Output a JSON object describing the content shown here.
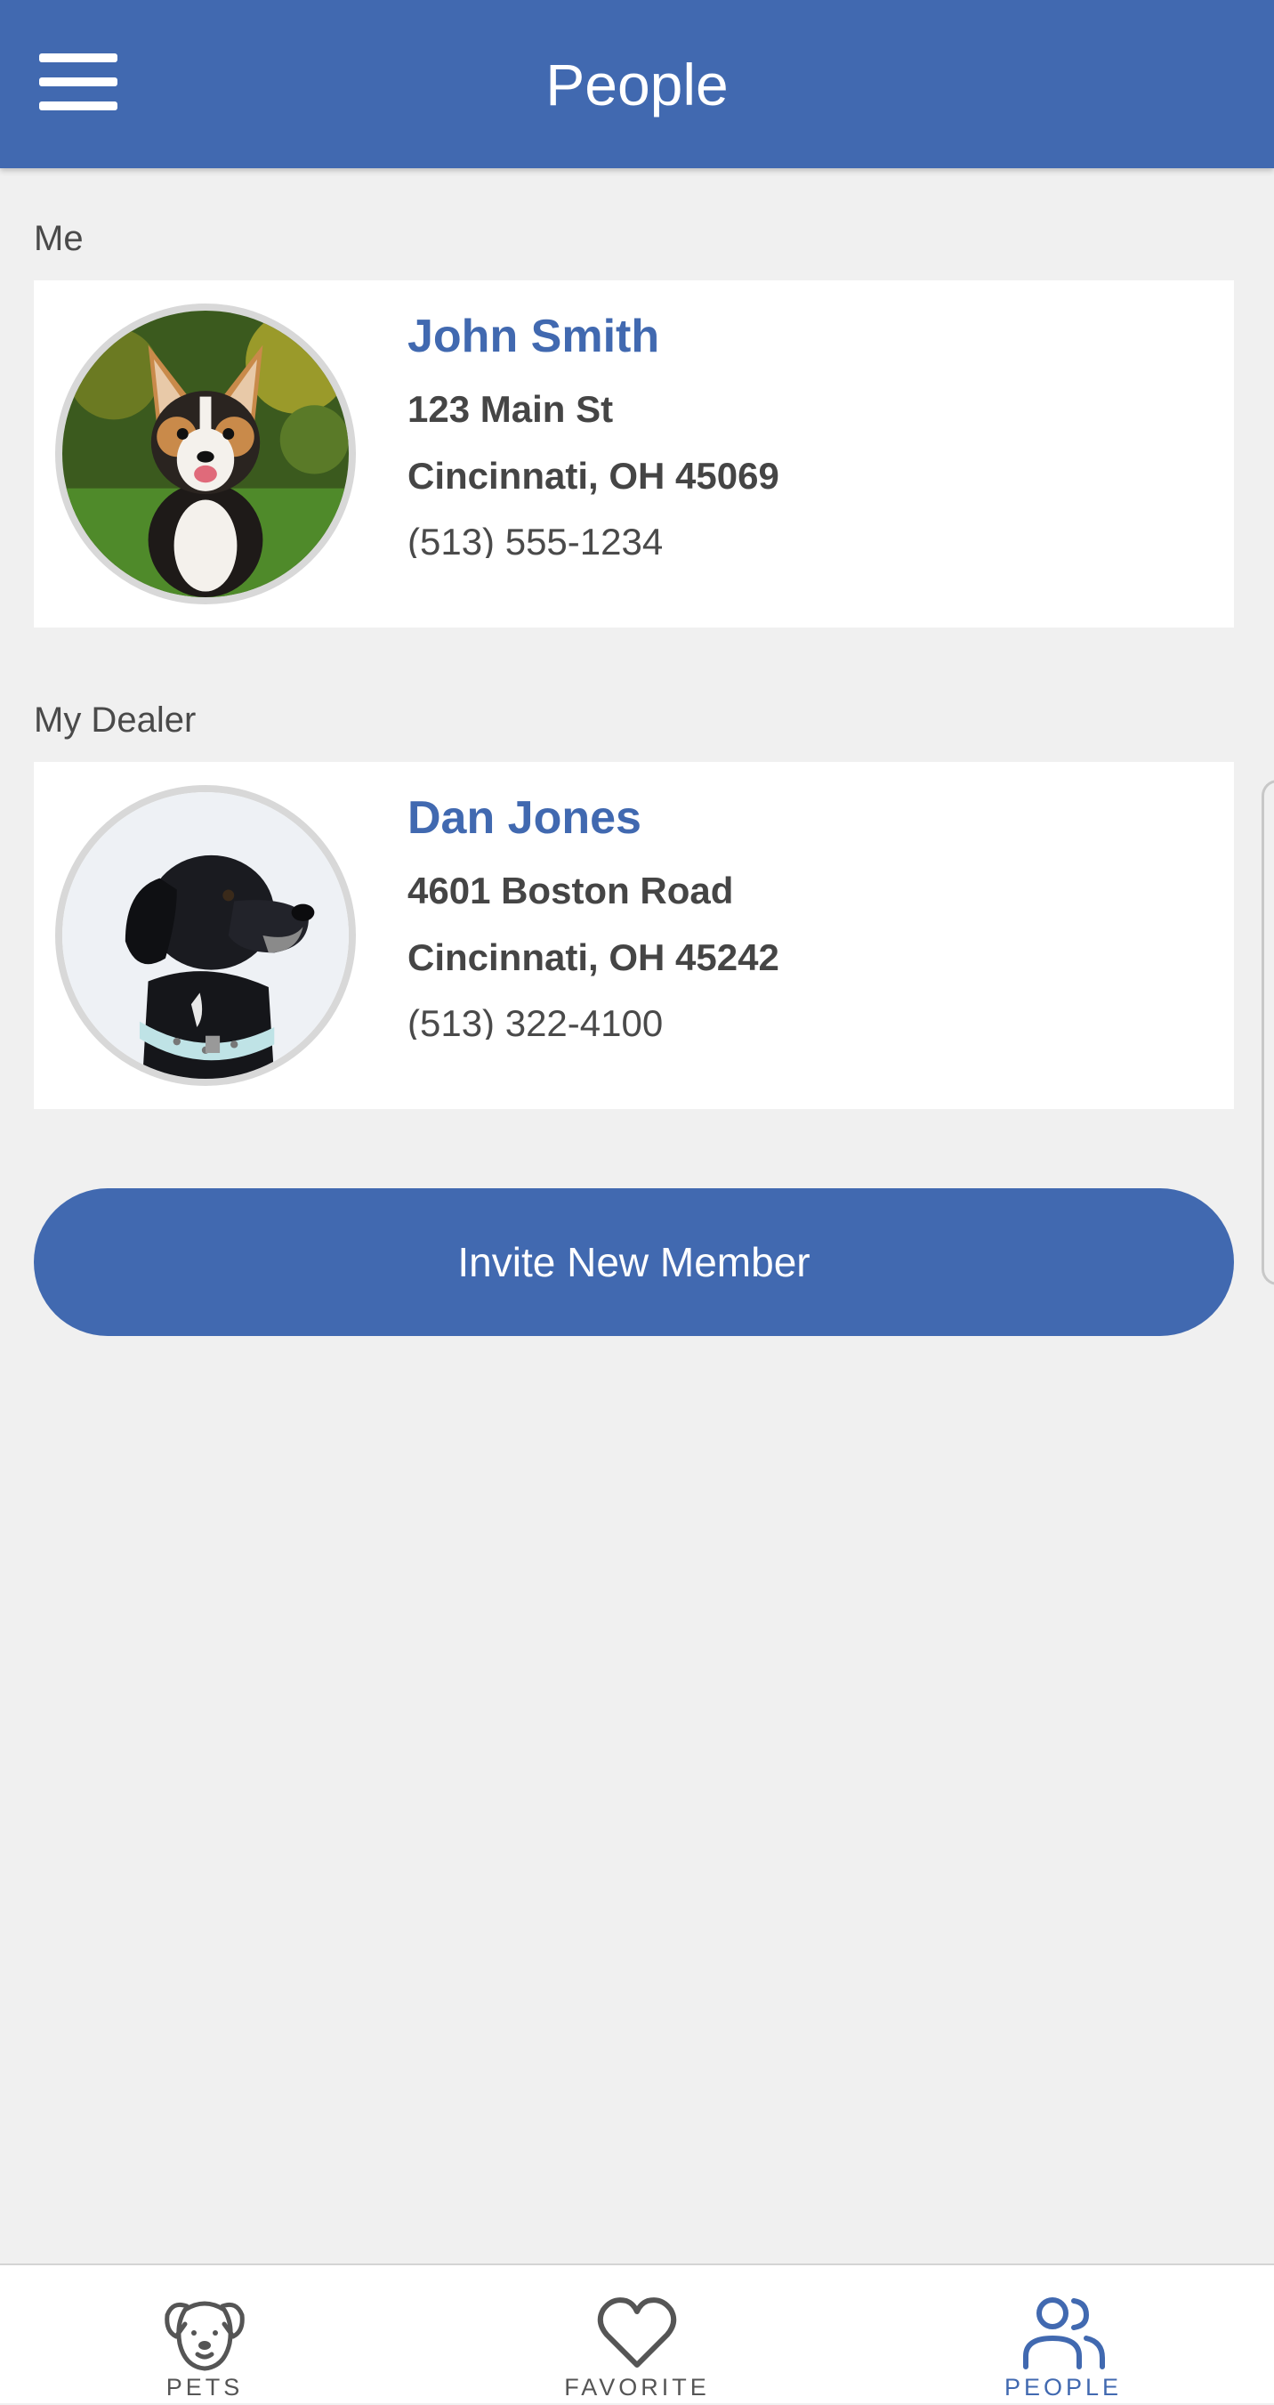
{
  "header": {
    "title": "People",
    "menu_icon": "hamburger-menu-icon"
  },
  "sections": {
    "me_label": "Me",
    "dealer_label": "My Dealer"
  },
  "me": {
    "name": "John Smith",
    "address_line1": "123 Main St",
    "address_line2": "Cincinnati, OH 45069",
    "phone": "(513) 555-1234",
    "avatar": "corgi-photo"
  },
  "dealer": {
    "name": "Dan Jones",
    "address_line1": "4601 Boston Road",
    "address_line2": "Cincinnati, OH 45242",
    "phone": "(513) 322-4100",
    "avatar": "black-labrador-photo"
  },
  "actions": {
    "invite_label": "Invite New Member"
  },
  "bottom_nav": {
    "items": [
      {
        "label": "PETS",
        "icon": "dog-face-icon",
        "active": false
      },
      {
        "label": "FAVORITE",
        "icon": "heart-icon",
        "active": false
      },
      {
        "label": "PEOPLE",
        "icon": "people-icon",
        "active": true
      }
    ]
  },
  "colors": {
    "primary": "#4169b0",
    "background": "#f0f0f0",
    "card": "#ffffff",
    "text_dark": "#454545"
  }
}
